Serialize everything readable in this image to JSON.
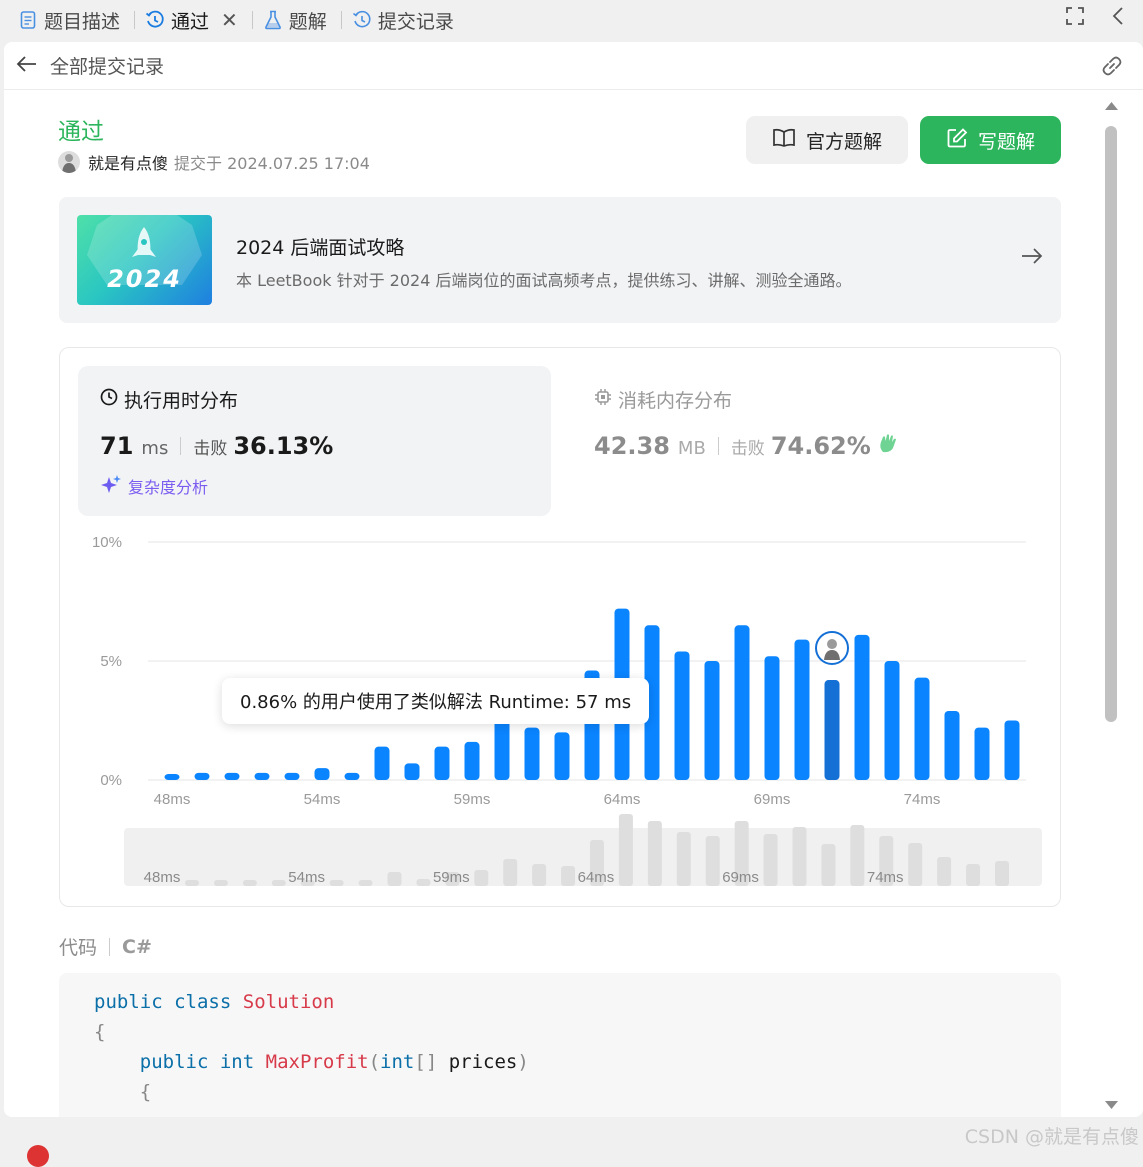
{
  "tabs": [
    {
      "label": "题目描述",
      "icon": "document-icon"
    },
    {
      "label": "通过",
      "icon": "history-icon"
    },
    {
      "label": "题解",
      "icon": "flask-icon"
    },
    {
      "label": "提交记录",
      "icon": "history-icon"
    }
  ],
  "header": {
    "back_title": "全部提交记录"
  },
  "submission": {
    "status": "通过",
    "user": "就是有点傻",
    "submitted_at": "提交于 2024.07.25 17:04"
  },
  "buttons": {
    "official_solution": "官方题解",
    "write_solution": "写题解"
  },
  "banner": {
    "image_text": "2024",
    "title": "2024 后端面试攻略",
    "description": "本 LeetBook 针对于 2024 后端岗位的面试高频考点，提供练习、讲解、测验全通路。"
  },
  "runtime": {
    "title": "执行用时分布",
    "value": "71",
    "unit": "ms",
    "beat_label": "击败",
    "beat_value": "36.13%",
    "complexity_link": "复杂度分析"
  },
  "memory": {
    "title": "消耗内存分布",
    "value": "42.38",
    "unit": "MB",
    "beat_label": "击败",
    "beat_value": "74.62%"
  },
  "tooltip": "0.86% 的用户使用了类似解法 Runtime: 57 ms",
  "chart_data": {
    "type": "bar",
    "ylabel_ticks": [
      "10%",
      "5%",
      "0%"
    ],
    "ylim": [
      0,
      10
    ],
    "x_ticks": [
      "48ms",
      "54ms",
      "59ms",
      "64ms",
      "69ms",
      "74ms"
    ],
    "values": [
      0.25,
      0.3,
      0.3,
      0.3,
      0.3,
      0.5,
      0.3,
      1.4,
      0.7,
      1.4,
      1.6,
      2.7,
      2.2,
      2.0,
      4.6,
      7.2,
      6.5,
      5.4,
      5.0,
      6.5,
      5.2,
      5.9,
      4.2,
      6.1,
      5.0,
      4.3,
      2.9,
      2.2,
      2.5
    ],
    "highlight_index": 22,
    "user_marker_index": 22,
    "bar_color": "#0a84ff",
    "highlight_color": "#1570d6",
    "grid": true
  },
  "code": {
    "label": "代码",
    "language": "C#",
    "lines": [
      [
        {
          "t": "public",
          "c": "kw"
        },
        {
          "t": " "
        },
        {
          "t": "class",
          "c": "kw"
        },
        {
          "t": " "
        },
        {
          "t": "Solution",
          "c": "typ"
        }
      ],
      [
        {
          "t": "{",
          "c": "pu"
        }
      ],
      [
        {
          "t": "    "
        },
        {
          "t": "public",
          "c": "kw"
        },
        {
          "t": " "
        },
        {
          "t": "int",
          "c": "kw"
        },
        {
          "t": " "
        },
        {
          "t": "MaxProfit",
          "c": "fn"
        },
        {
          "t": "(",
          "c": "pu"
        },
        {
          "t": "int",
          "c": "kw"
        },
        {
          "t": "[]",
          "c": "pu"
        },
        {
          "t": " prices",
          "c": "id"
        },
        {
          "t": ")",
          "c": "pu"
        }
      ],
      [
        {
          "t": "    "
        },
        {
          "t": "{",
          "c": "pu"
        }
      ]
    ]
  },
  "watermark": "CSDN @就是有点傻"
}
